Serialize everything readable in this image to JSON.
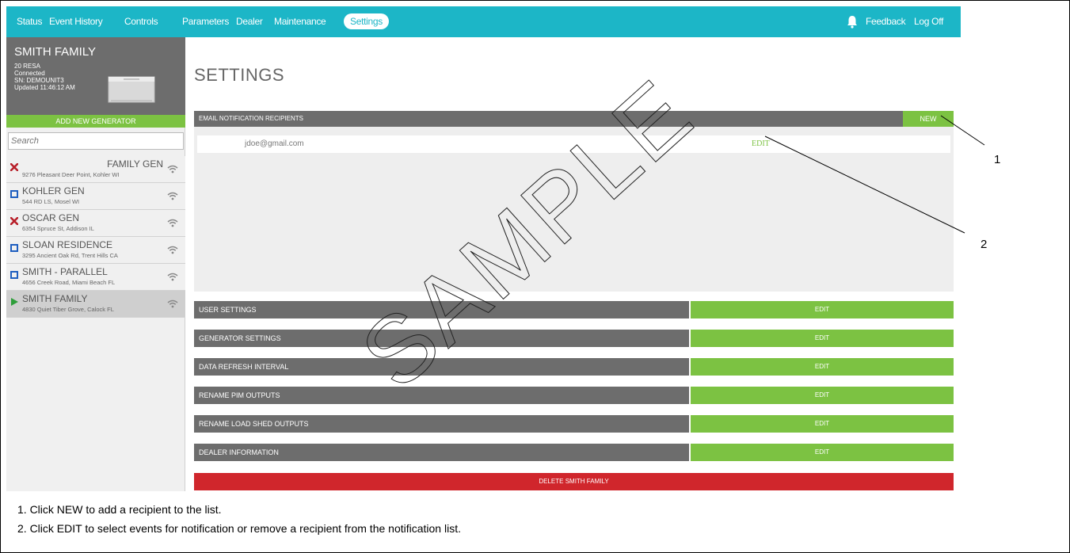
{
  "nav": {
    "items": [
      "Status",
      "Event History",
      "Controls",
      "Parameters",
      "Dealer",
      "Maintenance",
      "Settings"
    ],
    "active": "Settings",
    "feedback": "Feedback",
    "logoff": "Log Off"
  },
  "generator": {
    "name": "SMITH FAMILY",
    "model": "20 RESA",
    "status": "Connected",
    "serial": "SN: DEMOUNIT3",
    "updated": "Updated 11:46:12 AM"
  },
  "sidebar": {
    "add_button": "ADD NEW GENERATOR",
    "search_placeholder": "Search",
    "sites": [
      {
        "name": "FAMILY GEN",
        "address": "9276 Pleasant Deer Point, Kohler WI",
        "status": "fault"
      },
      {
        "name": "KOHLER GEN",
        "address": "544 RD LS, Mosel WI",
        "status": "ok"
      },
      {
        "name": "OSCAR GEN",
        "address": "6354 Spruce St, Addison IL",
        "status": "fault"
      },
      {
        "name": "SLOAN RESIDENCE",
        "address": "3295 Ancient Oak Rd, Trent Hills CA",
        "status": "ok"
      },
      {
        "name": "SMITH - PARALLEL",
        "address": "4656 Creek Road, Miami Beach FL",
        "status": "ok"
      },
      {
        "name": "SMITH FAMILY",
        "address": "4830 Quiet Tiber Grove, Calock FL",
        "status": "running"
      }
    ]
  },
  "main": {
    "title": "SETTINGS",
    "email_header": "EMAIL NOTIFICATION RECIPIENTS",
    "new_label": "NEW",
    "recipient": {
      "email": "jdoe@gmail.com",
      "edit_label": "EDIT"
    },
    "settings_rows": [
      {
        "label": "USER SETTINGS",
        "action": "EDIT"
      },
      {
        "label": "GENERATOR SETTINGS",
        "action": "EDIT"
      },
      {
        "label": "DATA REFRESH INTERVAL",
        "action": "EDIT"
      },
      {
        "label": "RENAME PIM OUTPUTS",
        "action": "EDIT"
      },
      {
        "label": "RENAME LOAD SHED OUTPUTS",
        "action": "EDIT"
      },
      {
        "label": "DEALER INFORMATION",
        "action": "EDIT"
      }
    ],
    "delete_label": "DELETE SMITH FAMILY"
  },
  "watermark": "SAMPLE",
  "callouts": [
    "1",
    "2"
  ],
  "captions": [
    "1. Click NEW to add a recipient to the list.",
    "2. Click EDIT to select events for notification or remove a recipient from the notification list."
  ],
  "colors": {
    "nav": "#1cb6c7",
    "accent_green": "#7cc242",
    "header_gray": "#6d6d6d",
    "danger_red": "#d0262c",
    "fault_red": "#b8202a",
    "ok_blue": "#1f5fc0",
    "running_green": "#2e9e3a"
  }
}
